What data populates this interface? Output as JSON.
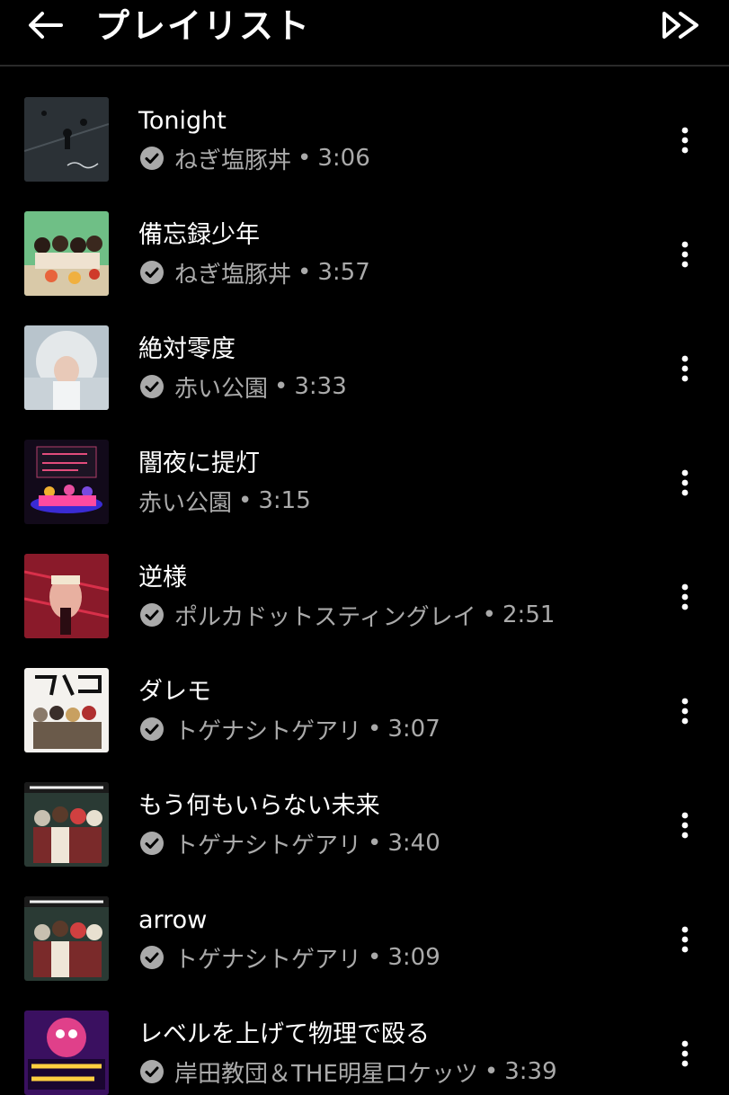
{
  "header": {
    "title": "プレイリスト",
    "back_icon": "arrow-left-icon",
    "skip_icon": "skip-forward-icon"
  },
  "separator": "•",
  "colors": {
    "background": "#000000",
    "primary_text": "#ffffff",
    "secondary_text": "#aaaaaa"
  },
  "tracks": [
    {
      "title": "Tonight",
      "artist": "ねぎ塩豚丼",
      "duration": "3:06",
      "verified": true
    },
    {
      "title": "備忘録少年",
      "artist": "ねぎ塩豚丼",
      "duration": "3:57",
      "verified": true
    },
    {
      "title": "絶対零度",
      "artist": "赤い公園",
      "duration": "3:33",
      "verified": true
    },
    {
      "title": "闇夜に提灯",
      "artist": "赤い公園",
      "duration": "3:15",
      "verified": false
    },
    {
      "title": "逆様",
      "artist": "ポルカドットスティングレイ",
      "duration": "2:51",
      "verified": true
    },
    {
      "title": "ダレモ",
      "artist": "トゲナシトゲアリ",
      "duration": "3:07",
      "verified": true
    },
    {
      "title": "もう何もいらない未来",
      "artist": "トゲナシトゲアリ",
      "duration": "3:40",
      "verified": true
    },
    {
      "title": "arrow",
      "artist": "トゲナシトゲアリ",
      "duration": "3:09",
      "verified": true
    },
    {
      "title": "レベルを上げて物理で殴る",
      "artist": "岸田教団＆THE明星ロケッツ",
      "duration": "3:39",
      "verified": true
    }
  ]
}
